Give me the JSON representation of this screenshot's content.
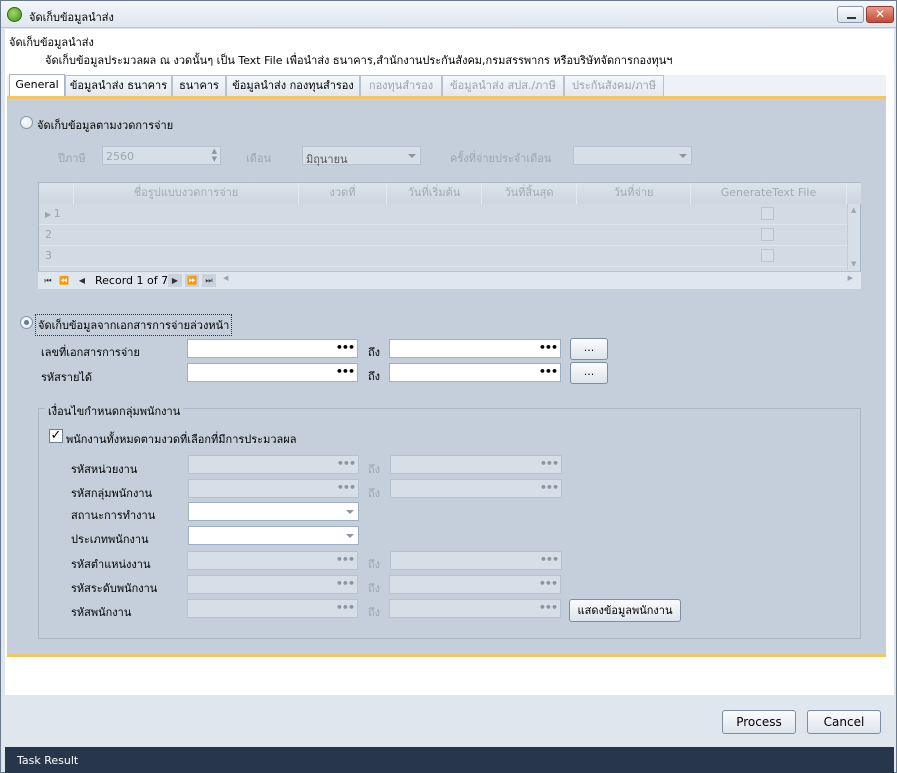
{
  "window": {
    "title": "จัดเก็บข้อมูลนำส่ง",
    "minimize_glyph": "—",
    "close_glyph": "✕"
  },
  "header": {
    "title": "จัดเก็บข้อมูลนำส่ง",
    "description": "จัดเก็บข้อมูลประมวลผล ณ งวดนั้นๆ เป็น Text File เพื่อนำส่ง ธนาคาร,สำนักงานประกันสังคม,กรมสรรพากร หรือบริษัทจัดการกองทุนฯ"
  },
  "tabs": [
    {
      "label": "General",
      "state": "active"
    },
    {
      "label": "ข้อมูลนำส่ง ธนาคาร",
      "state": "enabled"
    },
    {
      "label": "ธนาคาร",
      "state": "enabled"
    },
    {
      "label": "ข้อมูลนำส่ง กองทุนสำรอง",
      "state": "enabled"
    },
    {
      "label": "กองทุนสำรอง",
      "state": "disabled"
    },
    {
      "label": "ข้อมูลนำส่ง สปส./ภาษี",
      "state": "disabled"
    },
    {
      "label": "ประกันสังคม/ภาษี",
      "state": "disabled"
    }
  ],
  "section1": {
    "radio_label": "จัดเก็บข้อมูลตามงวดการจ่าย",
    "selected": false,
    "year_label": "ปีภาษี",
    "year_value": "2560",
    "month_label": "เดือน",
    "month_value": "มิถุนายน",
    "period_label": "ครั้งที่จ่ายประจำเดือน",
    "period_value": ""
  },
  "grid": {
    "columns": [
      "ชื่อรูปแบบงวดการจ่าย",
      "งวดที่",
      "วันที่เริ่มต้น",
      "วันที่สิ้นสุด",
      "วันที่จ่าย",
      "GenerateText File"
    ],
    "rows": [
      "1",
      "2",
      "3"
    ],
    "record_text": "Record 1 of 7"
  },
  "section2": {
    "radio_label": "จัดเก็บข้อมูลจากเอกสารการจ่ายล่วงหน้า",
    "selected": true,
    "doc_label": "เลขที่เอกสารการจ่าย",
    "income_label": "รหัสรายได้",
    "to_label": "ถึง",
    "browse_label": "..."
  },
  "group": {
    "title": "เงื่อนไขกำหนดกลุ่มพนักงาน",
    "all_checkbox_label": "พนักงานทั้งหมดตามงวดที่เลือกที่มีการประมวลผล",
    "all_checked": true,
    "fields": {
      "unit": "รหัสหน่วยงาน",
      "emp_group": "รหัสกลุ่มพนักงาน",
      "work_status": "สถานะการทำงาน",
      "emp_type": "ประเภทพนักงาน",
      "position": "รหัสตำแหน่งงาน",
      "level": "รหัสระดับพนักงาน",
      "employee": "รหัสพนักงาน"
    },
    "to_label": "ถึง",
    "show_button": "แสดงข้อมูลพนักงาน"
  },
  "footer": {
    "process": "Process",
    "cancel": "Cancel"
  },
  "taskbar": {
    "label": "Task Result"
  },
  "colors": {
    "panel": "#c4cfdb",
    "accent_border": "#f3c661",
    "taskbar": "#27364a"
  }
}
